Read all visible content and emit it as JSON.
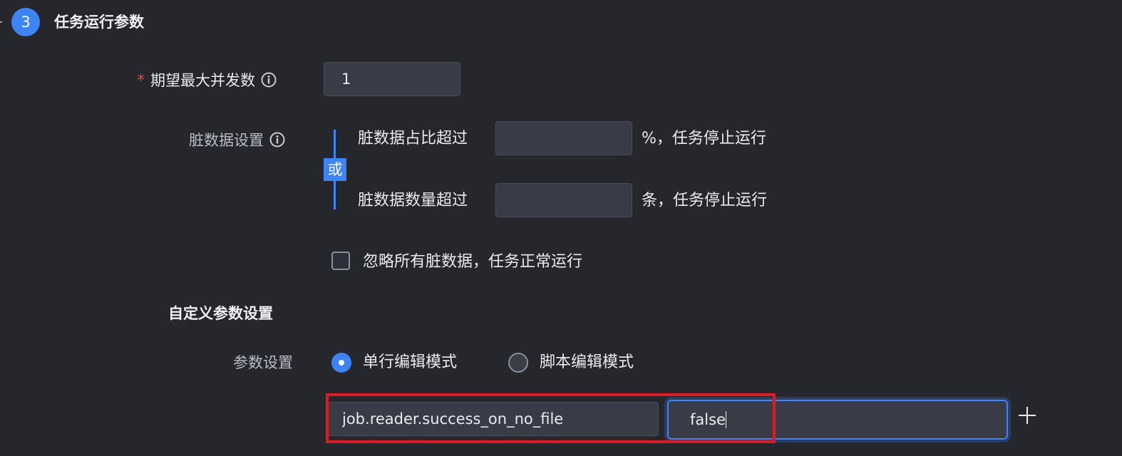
{
  "step": {
    "number": "3",
    "title": "任务运行参数"
  },
  "concurrency": {
    "required_mark": "*",
    "label": "期望最大并发数",
    "value": "1"
  },
  "dirty_data": {
    "label": "脏数据设置",
    "or_label": "或",
    "ratio_prefix": "脏数据占比超过",
    "ratio_value": "",
    "ratio_suffix": "%，任务停止运行",
    "count_prefix": "脏数据数量超过",
    "count_value": "",
    "count_suffix": "条，任务停止运行",
    "ignore_label": "忽略所有脏数据，任务正常运行",
    "ignore_checked": false
  },
  "custom_params": {
    "section_title": "自定义参数设置",
    "mode_label": "参数设置",
    "mode_single": "单行编辑模式",
    "mode_script": "脚本编辑模式",
    "selected_mode": "单行编辑模式",
    "param_key": "job.reader.success_on_no_file",
    "param_value": "false"
  },
  "colors": {
    "accent": "#3d84f7",
    "required": "#e24a4a",
    "highlight": "#e21920",
    "background": "#25272d"
  }
}
